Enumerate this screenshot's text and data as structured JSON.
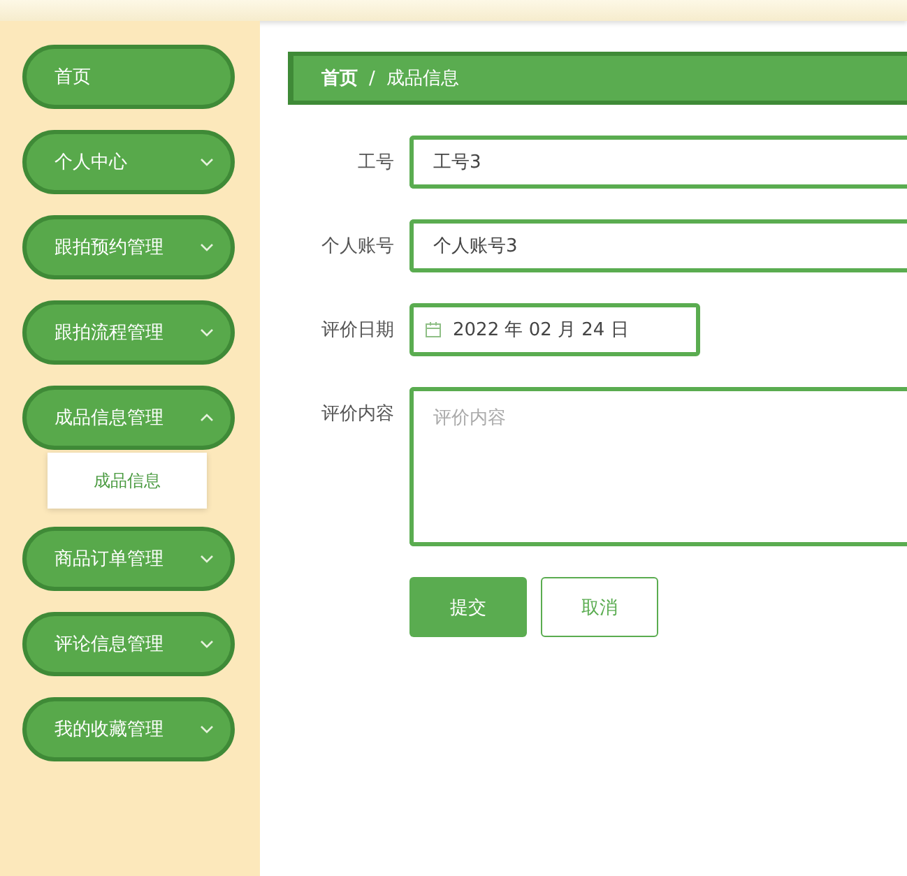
{
  "sidebar": {
    "items": [
      {
        "kind": "link",
        "label": "首页"
      },
      {
        "kind": "group",
        "label": "个人中心",
        "expanded": false
      },
      {
        "kind": "group",
        "label": "跟拍预约管理",
        "expanded": false
      },
      {
        "kind": "group",
        "label": "跟拍流程管理",
        "expanded": false
      },
      {
        "kind": "group",
        "label": "成品信息管理",
        "expanded": true,
        "children": [
          {
            "label": "成品信息"
          }
        ]
      },
      {
        "kind": "group",
        "label": "商品订单管理",
        "expanded": false
      },
      {
        "kind": "group",
        "label": "评论信息管理",
        "expanded": false
      },
      {
        "kind": "group",
        "label": "我的收藏管理",
        "expanded": false
      }
    ]
  },
  "breadcrumb": {
    "separator": "/",
    "items": [
      "首页",
      "成品信息"
    ]
  },
  "form": {
    "fields": [
      {
        "kind": "text",
        "label": "工号",
        "value": "工号3"
      },
      {
        "kind": "text",
        "label": "个人账号",
        "value": "个人账号3"
      },
      {
        "kind": "date",
        "label": "评价日期",
        "value": "2022 年 02 月 24 日"
      },
      {
        "kind": "textarea",
        "label": "评价内容",
        "placeholder": "评价内容"
      }
    ],
    "buttons": [
      {
        "kind": "primary",
        "label": "提交"
      },
      {
        "kind": "secondary",
        "label": "取消"
      }
    ]
  }
}
